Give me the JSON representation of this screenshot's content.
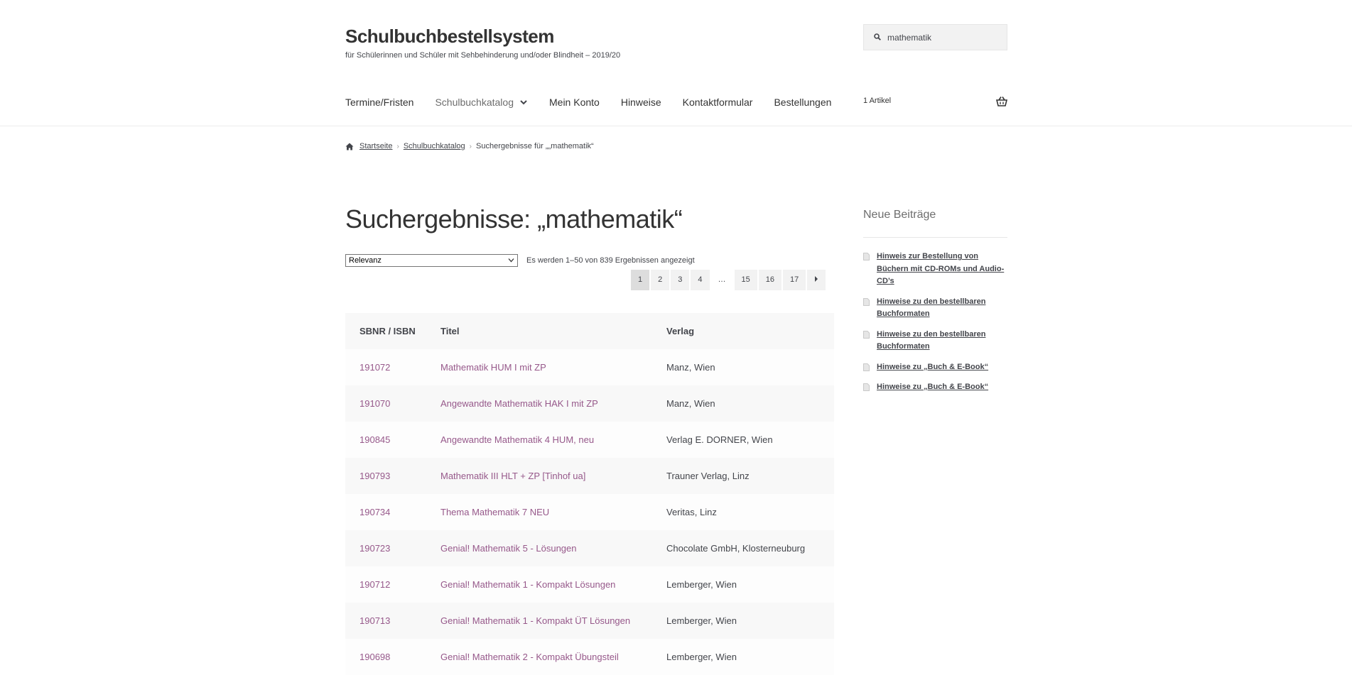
{
  "site": {
    "title": "Schulbuchbestellsystem",
    "description": "für Schülerinnen und Schüler mit Sehbehinderung und/oder Blindheit – 2019/20"
  },
  "search": {
    "value": "mathematik",
    "icon": "search-icon"
  },
  "nav": [
    {
      "label": "Termine/Fristen"
    },
    {
      "label": "Schulbuchkatalog",
      "active": true,
      "has_dropdown": true
    },
    {
      "label": "Mein Konto"
    },
    {
      "label": "Hinweise"
    },
    {
      "label": "Kontaktformular"
    },
    {
      "label": "Bestellungen"
    }
  ],
  "cart": {
    "label": "1 Artikel",
    "icon": "basket-icon"
  },
  "breadcrumb": {
    "home": "Startseite",
    "catalog": "Schulbuchkatalog",
    "current": "Suchergebnisse für „„mathematik“"
  },
  "page_title": "Suchergebnisse: „mathematik“",
  "orderby": {
    "selected": "Relevanz"
  },
  "result_count": "Es werden 1–50 von 839 Ergebnissen angezeigt",
  "pagination": [
    "1",
    "2",
    "3",
    "4",
    "…",
    "15",
    "16",
    "17"
  ],
  "table": {
    "headers": [
      "SBNR / ISBN",
      "Titel",
      "Verlag"
    ],
    "rows": [
      {
        "sbnr": "191072",
        "title": "Mathematik HUM I mit ZP",
        "publisher": "Manz, Wien"
      },
      {
        "sbnr": "191070",
        "title": "Angewandte Mathematik HAK I mit ZP",
        "publisher": "Manz, Wien"
      },
      {
        "sbnr": "190845",
        "title": "Angewandte Mathematik 4 HUM, neu",
        "publisher": "Verlag E. DORNER, Wien"
      },
      {
        "sbnr": "190793",
        "title": "Mathematik III HLT + ZP [Tinhof ua]",
        "publisher": "Trauner Verlag, Linz"
      },
      {
        "sbnr": "190734",
        "title": "Thema Mathematik 7 NEU",
        "publisher": "Veritas, Linz"
      },
      {
        "sbnr": "190723",
        "title": "Genial! Mathematik 5 - Lösungen",
        "publisher": "Chocolate GmbH, Klosterneuburg"
      },
      {
        "sbnr": "190712",
        "title": "Genial! Mathematik 1 - Kompakt Lösungen",
        "publisher": "Lemberger, Wien"
      },
      {
        "sbnr": "190713",
        "title": "Genial! Mathematik 1 - Kompakt ÜT Lösungen",
        "publisher": "Lemberger, Wien"
      },
      {
        "sbnr": "190698",
        "title": "Genial! Mathematik 2 - Kompakt Übungsteil",
        "publisher": "Lemberger, Wien"
      }
    ]
  },
  "sidebar": {
    "title": "Neue Beiträge",
    "posts": [
      "Hinweis zur Bestellung von Büchern mit CD-ROMs und Audio-CD’s",
      "Hinweise zu den bestellbaren Buchformaten",
      "Hinweise zu den bestellbaren Buchformaten",
      "Hinweise zu „Buch & E-Book“",
      "Hinweise zu „Buch & E-Book“"
    ]
  },
  "colors": {
    "link": "#96588a",
    "text": "#43454b",
    "row_alt": "#f8f8f8"
  }
}
